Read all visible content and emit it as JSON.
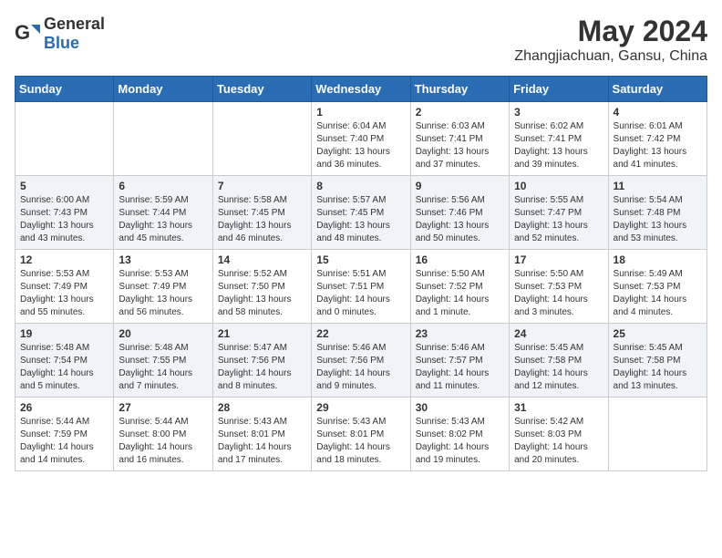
{
  "header": {
    "logo_general": "General",
    "logo_blue": "Blue",
    "month_year": "May 2024",
    "location": "Zhangjiachuan, Gansu, China"
  },
  "days_of_week": [
    "Sunday",
    "Monday",
    "Tuesday",
    "Wednesday",
    "Thursday",
    "Friday",
    "Saturday"
  ],
  "weeks": [
    [
      {
        "day": "",
        "info": ""
      },
      {
        "day": "",
        "info": ""
      },
      {
        "day": "",
        "info": ""
      },
      {
        "day": "1",
        "info": "Sunrise: 6:04 AM\nSunset: 7:40 PM\nDaylight: 13 hours\nand 36 minutes."
      },
      {
        "day": "2",
        "info": "Sunrise: 6:03 AM\nSunset: 7:41 PM\nDaylight: 13 hours\nand 37 minutes."
      },
      {
        "day": "3",
        "info": "Sunrise: 6:02 AM\nSunset: 7:41 PM\nDaylight: 13 hours\nand 39 minutes."
      },
      {
        "day": "4",
        "info": "Sunrise: 6:01 AM\nSunset: 7:42 PM\nDaylight: 13 hours\nand 41 minutes."
      }
    ],
    [
      {
        "day": "5",
        "info": "Sunrise: 6:00 AM\nSunset: 7:43 PM\nDaylight: 13 hours\nand 43 minutes."
      },
      {
        "day": "6",
        "info": "Sunrise: 5:59 AM\nSunset: 7:44 PM\nDaylight: 13 hours\nand 45 minutes."
      },
      {
        "day": "7",
        "info": "Sunrise: 5:58 AM\nSunset: 7:45 PM\nDaylight: 13 hours\nand 46 minutes."
      },
      {
        "day": "8",
        "info": "Sunrise: 5:57 AM\nSunset: 7:45 PM\nDaylight: 13 hours\nand 48 minutes."
      },
      {
        "day": "9",
        "info": "Sunrise: 5:56 AM\nSunset: 7:46 PM\nDaylight: 13 hours\nand 50 minutes."
      },
      {
        "day": "10",
        "info": "Sunrise: 5:55 AM\nSunset: 7:47 PM\nDaylight: 13 hours\nand 52 minutes."
      },
      {
        "day": "11",
        "info": "Sunrise: 5:54 AM\nSunset: 7:48 PM\nDaylight: 13 hours\nand 53 minutes."
      }
    ],
    [
      {
        "day": "12",
        "info": "Sunrise: 5:53 AM\nSunset: 7:49 PM\nDaylight: 13 hours\nand 55 minutes."
      },
      {
        "day": "13",
        "info": "Sunrise: 5:53 AM\nSunset: 7:49 PM\nDaylight: 13 hours\nand 56 minutes."
      },
      {
        "day": "14",
        "info": "Sunrise: 5:52 AM\nSunset: 7:50 PM\nDaylight: 13 hours\nand 58 minutes."
      },
      {
        "day": "15",
        "info": "Sunrise: 5:51 AM\nSunset: 7:51 PM\nDaylight: 14 hours\nand 0 minutes."
      },
      {
        "day": "16",
        "info": "Sunrise: 5:50 AM\nSunset: 7:52 PM\nDaylight: 14 hours\nand 1 minute."
      },
      {
        "day": "17",
        "info": "Sunrise: 5:50 AM\nSunset: 7:53 PM\nDaylight: 14 hours\nand 3 minutes."
      },
      {
        "day": "18",
        "info": "Sunrise: 5:49 AM\nSunset: 7:53 PM\nDaylight: 14 hours\nand 4 minutes."
      }
    ],
    [
      {
        "day": "19",
        "info": "Sunrise: 5:48 AM\nSunset: 7:54 PM\nDaylight: 14 hours\nand 5 minutes."
      },
      {
        "day": "20",
        "info": "Sunrise: 5:48 AM\nSunset: 7:55 PM\nDaylight: 14 hours\nand 7 minutes."
      },
      {
        "day": "21",
        "info": "Sunrise: 5:47 AM\nSunset: 7:56 PM\nDaylight: 14 hours\nand 8 minutes."
      },
      {
        "day": "22",
        "info": "Sunrise: 5:46 AM\nSunset: 7:56 PM\nDaylight: 14 hours\nand 9 minutes."
      },
      {
        "day": "23",
        "info": "Sunrise: 5:46 AM\nSunset: 7:57 PM\nDaylight: 14 hours\nand 11 minutes."
      },
      {
        "day": "24",
        "info": "Sunrise: 5:45 AM\nSunset: 7:58 PM\nDaylight: 14 hours\nand 12 minutes."
      },
      {
        "day": "25",
        "info": "Sunrise: 5:45 AM\nSunset: 7:58 PM\nDaylight: 14 hours\nand 13 minutes."
      }
    ],
    [
      {
        "day": "26",
        "info": "Sunrise: 5:44 AM\nSunset: 7:59 PM\nDaylight: 14 hours\nand 14 minutes."
      },
      {
        "day": "27",
        "info": "Sunrise: 5:44 AM\nSunset: 8:00 PM\nDaylight: 14 hours\nand 16 minutes."
      },
      {
        "day": "28",
        "info": "Sunrise: 5:43 AM\nSunset: 8:01 PM\nDaylight: 14 hours\nand 17 minutes."
      },
      {
        "day": "29",
        "info": "Sunrise: 5:43 AM\nSunset: 8:01 PM\nDaylight: 14 hours\nand 18 minutes."
      },
      {
        "day": "30",
        "info": "Sunrise: 5:43 AM\nSunset: 8:02 PM\nDaylight: 14 hours\nand 19 minutes."
      },
      {
        "day": "31",
        "info": "Sunrise: 5:42 AM\nSunset: 8:03 PM\nDaylight: 14 hours\nand 20 minutes."
      },
      {
        "day": "",
        "info": ""
      }
    ]
  ]
}
